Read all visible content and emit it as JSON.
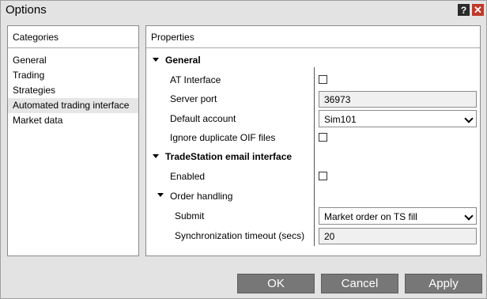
{
  "window": {
    "title": "Options",
    "help_label": "?",
    "close_label": "✕"
  },
  "categories": {
    "header": "Categories",
    "items": [
      {
        "label": "General",
        "selected": false
      },
      {
        "label": "Trading",
        "selected": false
      },
      {
        "label": "Strategies",
        "selected": false
      },
      {
        "label": "Automated trading interface",
        "selected": true
      },
      {
        "label": "Market data",
        "selected": false
      }
    ]
  },
  "properties": {
    "header": "Properties",
    "general_section": {
      "label": "General",
      "at_interface": {
        "label": "AT Interface",
        "checked": false
      },
      "server_port": {
        "label": "Server port",
        "value": "36973"
      },
      "default_account": {
        "label": "Default account",
        "value": "Sim101"
      },
      "ignore_duplicate": {
        "label": "Ignore duplicate OIF files",
        "checked": false
      }
    },
    "tradestation_section": {
      "label": "TradeStation email interface",
      "enabled": {
        "label": "Enabled",
        "checked": false
      },
      "order_handling": {
        "label": "Order handling",
        "submit": {
          "label": "Submit",
          "value": "Market order on TS fill"
        },
        "sync_timeout": {
          "label": "Synchronization timeout (secs)",
          "value": "20"
        }
      }
    }
  },
  "buttons": {
    "ok": "OK",
    "cancel": "Cancel",
    "apply": "Apply"
  },
  "colors": {
    "window_bg": "#e3e3e3",
    "button_bg": "#777777",
    "close_bg": "#c0392b"
  }
}
